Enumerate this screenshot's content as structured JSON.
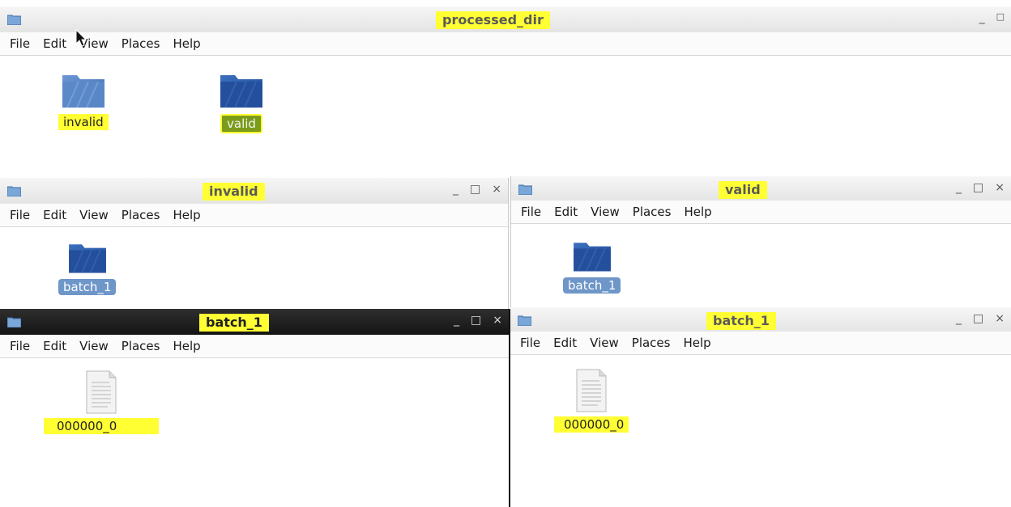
{
  "menu": [
    "File",
    "Edit",
    "View",
    "Places",
    "Help"
  ],
  "controls": {
    "minimize": "_",
    "maximize": "□",
    "close": "×"
  },
  "windows": {
    "processed_dir": {
      "title": "processed_dir",
      "items": [
        {
          "label": "invalid",
          "type": "folder"
        },
        {
          "label": "valid",
          "type": "folder"
        }
      ]
    },
    "invalid": {
      "title": "invalid",
      "items": [
        {
          "label": "batch_1",
          "type": "folder"
        }
      ]
    },
    "valid": {
      "title": "valid",
      "items": [
        {
          "label": "batch_1",
          "type": "folder"
        }
      ]
    },
    "batch_invalid": {
      "title": "batch_1",
      "items": [
        {
          "label": "000000_0",
          "type": "file"
        }
      ]
    },
    "batch_valid": {
      "title": "batch_1",
      "items": [
        {
          "label": "000000_0",
          "type": "file"
        }
      ]
    }
  },
  "colors": {
    "highlight": "#ffff33",
    "folder": "#2a5aa8",
    "selection": "#6e96c8",
    "title_text": "#5a5a5a"
  }
}
